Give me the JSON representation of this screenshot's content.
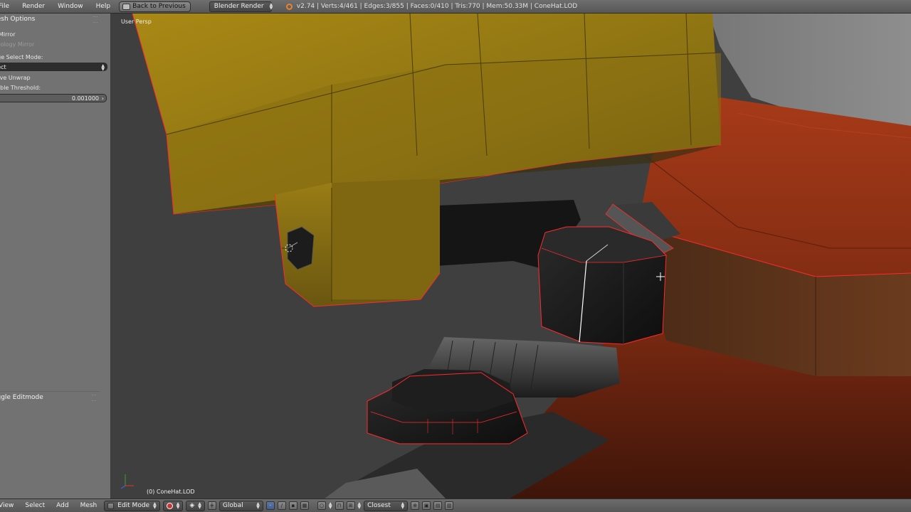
{
  "topbar": {
    "menus": [
      "File",
      "Render",
      "Window",
      "Help"
    ],
    "back_button": "Back to Previous",
    "render_engine": "Blender Render",
    "stats": "v2.74 | Verts:4/461 | Edges:3/855 | Faces:0/410 | Tris:770 | Mem:50.33M | ConeHat.LOD"
  },
  "tool_shelf": {
    "mesh_options_title": "Mesh Options",
    "x_mirror": "X Mirror",
    "topology_mirror": "Topology Mirror",
    "edge_select_mode_label": "Edge Select Mode:",
    "edge_select_value": "Select",
    "live_unwrap": "Live Unwrap",
    "double_threshold_label": "Double Threshold:",
    "double_threshold_value": "0.001000",
    "toggle_editmode_title": "Toggle Editmode"
  },
  "viewport": {
    "view_label": "User Persp",
    "object_label": "(0) ConeHat.LOD"
  },
  "bottombar": {
    "menus": [
      "View",
      "Select",
      "Add",
      "Mesh"
    ],
    "mode": "Edit Mode",
    "orientation": "Global",
    "snap_target": "Closest"
  },
  "colors": {
    "header_bg": "#636363",
    "panel_bg": "#727272",
    "viewport_bg": "#3f3f3f",
    "selection_edge": "#ff2a2a",
    "hat_yellow": "#b89a1a",
    "body_orange": "#a8381a"
  },
  "icons": {
    "back": "screen-back-icon",
    "logo": "blender-logo-icon",
    "cursor": "3d-cursor-icon",
    "axis": "axis-gizmo-icon"
  }
}
